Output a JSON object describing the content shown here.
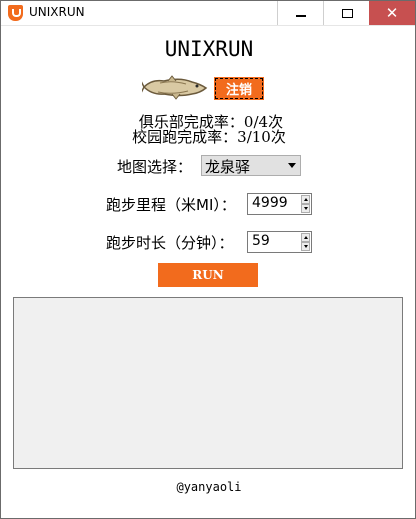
{
  "window": {
    "title": "UNIXRUN",
    "controls": {
      "minimize": "minimize",
      "maximize": "maximize",
      "close": "✕"
    }
  },
  "header": {
    "title": "UNIXRUN",
    "logout_label": "注销"
  },
  "stats": {
    "club_rate": "俱乐部完成率：0/4次",
    "campus_rate": "校园跑完成率：3/10次"
  },
  "map": {
    "label": "地图选择：",
    "selected": "龙泉驿"
  },
  "distance": {
    "label": "跑步里程（米MI）：",
    "value": "4999"
  },
  "duration": {
    "label": "跑步时长（分钟）：",
    "value": "59"
  },
  "run_button": {
    "label": "RUN"
  },
  "footer": {
    "credit": "@yanyaoli"
  },
  "colors": {
    "accent": "#f26b1d",
    "close_button": "#c75050",
    "log_background": "#f0f0f0"
  },
  "icons": [
    "app-logo-icon",
    "fish-icon",
    "chevron-down-icon",
    "spin-up-icon",
    "spin-down-icon"
  ]
}
